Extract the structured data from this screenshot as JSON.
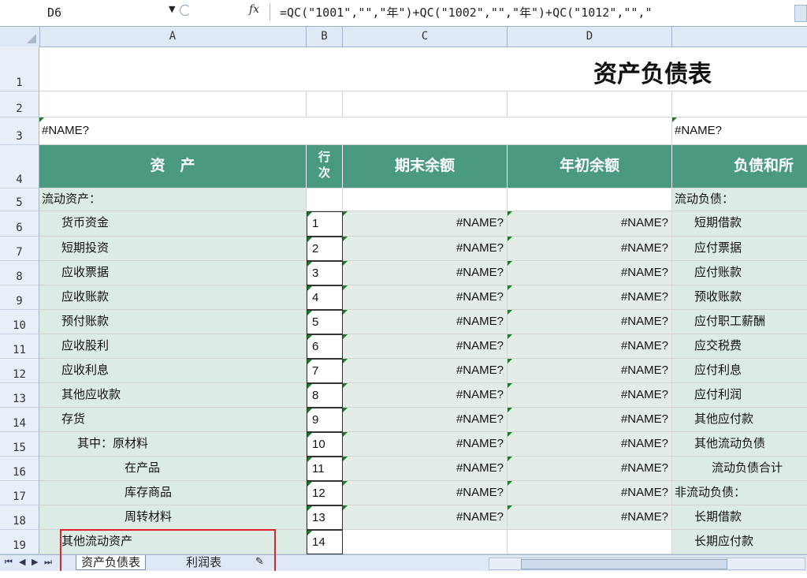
{
  "formula_bar": {
    "name_box": "D6",
    "dropdown_icon": "▼",
    "fx_label": "fx",
    "formula": "=QC(\"1001\",\"\",\"年\")+QC(\"1002\",\"\",\"年\")+QC(\"1012\",\"\",\""
  },
  "columns": [
    "A",
    "B",
    "C",
    "D",
    ""
  ],
  "title": "资产负债表",
  "name_errors": {
    "a3": "#NAME?",
    "e3": "#NAME?"
  },
  "header": {
    "asset": "资　产",
    "line_no": "行次",
    "end_balance": "期末余额",
    "begin_balance": "年初余额",
    "liability": "负债和所"
  },
  "rows": [
    {
      "row": "5",
      "asset": "流动资产：",
      "line": "",
      "end": "",
      "begin": "",
      "liab": "流动负债："
    },
    {
      "row": "6",
      "asset": "货币资金",
      "line": "1",
      "end": "#NAME?",
      "begin": "#NAME?",
      "liab": "短期借款"
    },
    {
      "row": "7",
      "asset": "短期投资",
      "line": "2",
      "end": "#NAME?",
      "begin": "#NAME?",
      "liab": "应付票据"
    },
    {
      "row": "8",
      "asset": "应收票据",
      "line": "3",
      "end": "#NAME?",
      "begin": "#NAME?",
      "liab": "应付账款"
    },
    {
      "row": "9",
      "asset": "应收账款",
      "line": "4",
      "end": "#NAME?",
      "begin": "#NAME?",
      "liab": "预收账款"
    },
    {
      "row": "10",
      "asset": "预付账款",
      "line": "5",
      "end": "#NAME?",
      "begin": "#NAME?",
      "liab": "应付职工薪酬"
    },
    {
      "row": "11",
      "asset": "应收股利",
      "line": "6",
      "end": "#NAME?",
      "begin": "#NAME?",
      "liab": "应交税费"
    },
    {
      "row": "12",
      "asset": "应收利息",
      "line": "7",
      "end": "#NAME?",
      "begin": "#NAME?",
      "liab": "应付利息"
    },
    {
      "row": "13",
      "asset": "其他应收款",
      "line": "8",
      "end": "#NAME?",
      "begin": "#NAME?",
      "liab": "应付利润"
    },
    {
      "row": "14",
      "asset": "存货",
      "line": "9",
      "end": "#NAME?",
      "begin": "#NAME?",
      "liab": "其他应付款"
    },
    {
      "row": "15",
      "asset": "其中：原材料",
      "line": "10",
      "end": "#NAME?",
      "begin": "#NAME?",
      "liab": "其他流动负债"
    },
    {
      "row": "16",
      "asset": "在产品",
      "line": "11",
      "end": "#NAME?",
      "begin": "#NAME?",
      "liab": "流动负债合计"
    },
    {
      "row": "17",
      "asset": "库存商品",
      "line": "12",
      "end": "#NAME?",
      "begin": "#NAME?",
      "liab": "非流动负债："
    },
    {
      "row": "18",
      "asset": "周转材料",
      "line": "13",
      "end": "#NAME?",
      "begin": "#NAME?",
      "liab": "长期借款"
    },
    {
      "row": "19",
      "asset": "其他流动资产",
      "line": "14",
      "end": "",
      "begin": "",
      "liab": "长期应付款"
    }
  ],
  "sheet_tabs": [
    "资产负债表",
    "利润表"
  ],
  "new_sheet_icon": "insert-sheet-icon"
}
